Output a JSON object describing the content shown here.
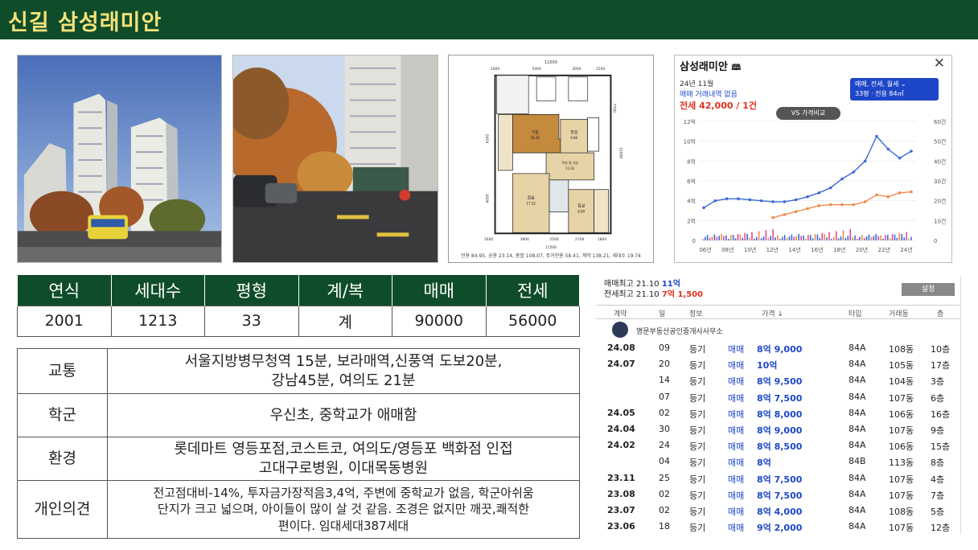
{
  "title": "신길 삼성래미안",
  "floorplan": {
    "caption": "전용 84.95, 공용 23.14, 총합 108.07, 주거전용 58.41, 계약 138.21, 세대수 19.74",
    "rooms": [
      {
        "label": "거실",
        "sub": "29.28"
      },
      {
        "label": "침실",
        "sub": "9.86"
      },
      {
        "label": "주방 및 식당",
        "sub": "11.91"
      },
      {
        "label": "침실",
        "sub": "17.52"
      },
      {
        "label": "침실",
        "sub": "8.89"
      }
    ],
    "dims": {
      "top_total": "11500",
      "top": [
        "1600",
        "5400",
        "3000",
        "1500"
      ],
      "bottom": [
        "1600",
        "3900",
        "2500",
        "2700",
        "1800"
      ],
      "bottom_total": "11500",
      "left": [
        "4300",
        "4000"
      ],
      "right": [
        "7700",
        "11600"
      ]
    }
  },
  "price_panel": {
    "title": "삼성래미안",
    "close_label": "✕",
    "month": "24년 11월",
    "no_trade": "매매 거래내역 없음",
    "jeonse": "전세 42,000 / 1건",
    "vs_label": "VS 가격비교",
    "filter_line1": "매매, 전세, 월세",
    "filter_line2": "33평 · 전용 84㎡",
    "y_left": [
      "12억",
      "10억",
      "8억",
      "6억",
      "4억",
      "2억",
      "0"
    ],
    "y_right": [
      "60건",
      "50건",
      "40건",
      "30건",
      "20건",
      "10건",
      "0"
    ],
    "x_labels": [
      "06년",
      "08년",
      "10년",
      "12년",
      "14년",
      "16년",
      "18년",
      "20년",
      "22년",
      "24년"
    ]
  },
  "chart_data": {
    "type": "line",
    "title": "",
    "x": [
      "06년",
      "07년",
      "08년",
      "09년",
      "10년",
      "11년",
      "12년",
      "13년",
      "14년",
      "15년",
      "16년",
      "17년",
      "18년",
      "19년",
      "20년",
      "21년",
      "22년",
      "23년",
      "24년"
    ],
    "series": [
      {
        "name": "매매",
        "values": [
          3.3,
          4.0,
          4.2,
          4.2,
          4.1,
          4.0,
          3.9,
          3.9,
          4.1,
          4.4,
          4.8,
          5.3,
          6.2,
          6.9,
          8.0,
          10.5,
          9.2,
          8.3,
          9.0
        ]
      },
      {
        "name": "전세",
        "values": [
          null,
          null,
          null,
          null,
          null,
          null,
          2.3,
          2.6,
          2.9,
          3.2,
          3.5,
          3.6,
          3.6,
          3.6,
          3.9,
          4.6,
          4.4,
          4.8,
          4.9
        ]
      }
    ],
    "ylim": [
      0,
      12
    ],
    "y_unit": "억",
    "y2lim": [
      0,
      60
    ],
    "y2_unit": "건"
  },
  "stats": {
    "headers": [
      "연식",
      "세대수",
      "평형",
      "계/복",
      "매매",
      "전세"
    ],
    "values": [
      "2001",
      "1213",
      "33",
      "계",
      "90000",
      "56000"
    ]
  },
  "info": [
    {
      "key": "교통",
      "lines": [
        "서울지방병무청역 15분, 보라매역,신풍역 도보20분,",
        "강남45분, 여의도 21분"
      ]
    },
    {
      "key": "학군",
      "lines": [
        "우신초, 중학교가 애매함"
      ]
    },
    {
      "key": "환경",
      "lines": [
        "롯데마트 영등포점,코스트코, 여의도/영등포 백화점 인접",
        "고대구로병원, 이대목동병원"
      ]
    },
    {
      "key": "개인의견",
      "lines": [
        "전고점대비-14%, 투자금가장적음3,4억, 주변에 중학교가 없음, 학군아쉬움",
        "단지가 크고 넓으며, 아이들이 많이 살 것 같음. 조경은 없지만 깨끗,쾌적한",
        "편이다. 임대세대387세대"
      ]
    }
  ],
  "transactions": {
    "max_sale_label": "매매최고",
    "max_sale_date": "21.10",
    "max_sale_value": "11억",
    "max_jeonse_label": "전세최고",
    "max_jeonse_date": "21.10",
    "max_jeonse_value": "7억 1,500",
    "settings_label": "설정",
    "columns": [
      "계약",
      "일",
      "정보",
      "가격 ↓",
      "타입",
      "거래동",
      "층"
    ],
    "broker": "명문부동산공인중개사사무소",
    "rows": [
      {
        "date": "24.08",
        "day": "09",
        "kind": "등기",
        "type": "매매",
        "price": "8억 9,000",
        "area": "84A",
        "dong": "108동",
        "floor": "10층"
      },
      {
        "date": "24.07",
        "day": "20",
        "kind": "등기",
        "type": "매매",
        "price": "10억",
        "area": "84A",
        "dong": "105동",
        "floor": "17층"
      },
      {
        "date": "",
        "day": "14",
        "kind": "등기",
        "type": "매매",
        "price": "8억 9,500",
        "area": "84A",
        "dong": "104동",
        "floor": "3층"
      },
      {
        "date": "",
        "day": "07",
        "kind": "등기",
        "type": "매매",
        "price": "8억 7,500",
        "area": "84A",
        "dong": "107동",
        "floor": "6층"
      },
      {
        "date": "24.05",
        "day": "02",
        "kind": "등기",
        "type": "매매",
        "price": "8억 8,000",
        "area": "84A",
        "dong": "106동",
        "floor": "16층"
      },
      {
        "date": "24.04",
        "day": "30",
        "kind": "등기",
        "type": "매매",
        "price": "8억 9,000",
        "area": "84A",
        "dong": "107동",
        "floor": "9층"
      },
      {
        "date": "24.02",
        "day": "24",
        "kind": "등기",
        "type": "매매",
        "price": "8억 8,500",
        "area": "84A",
        "dong": "106동",
        "floor": "15층"
      },
      {
        "date": "",
        "day": "04",
        "kind": "등기",
        "type": "매매",
        "price": "8억",
        "area": "84B",
        "dong": "113동",
        "floor": "8층"
      },
      {
        "date": "23.11",
        "day": "25",
        "kind": "등기",
        "type": "매매",
        "price": "8억 7,500",
        "area": "84A",
        "dong": "107동",
        "floor": "4층"
      },
      {
        "date": "23.08",
        "day": "02",
        "kind": "등기",
        "type": "매매",
        "price": "8억 7,500",
        "area": "84A",
        "dong": "107동",
        "floor": "7층"
      },
      {
        "date": "23.07",
        "day": "02",
        "kind": "등기",
        "type": "매매",
        "price": "8억 4,000",
        "area": "84A",
        "dong": "108동",
        "floor": "5층"
      },
      {
        "date": "23.06",
        "day": "18",
        "kind": "등기",
        "type": "매매",
        "price": "9억 2,000",
        "area": "84A",
        "dong": "107동",
        "floor": "12층"
      }
    ]
  },
  "colors": {
    "header_bg": "#0f4d2a",
    "title": "#f5e27a",
    "sale_line": "#3a6ad8",
    "jeonse_line": "#f08a4b",
    "accent_blue": "#1e46c8",
    "accent_red": "#e0321e"
  }
}
